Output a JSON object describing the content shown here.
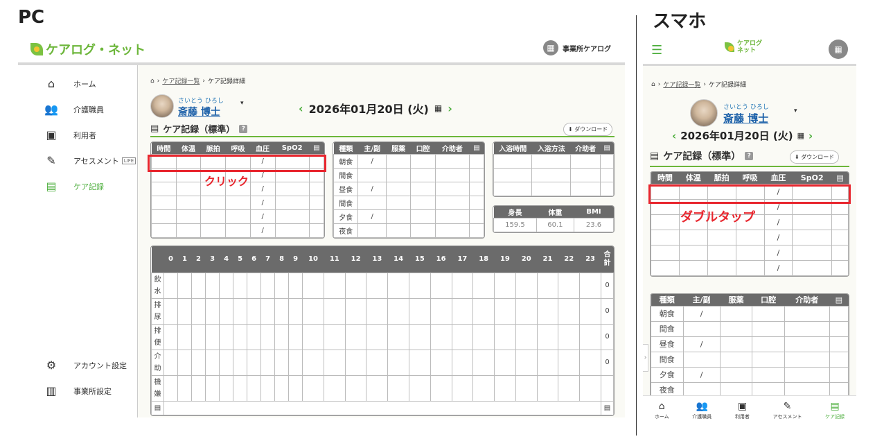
{
  "labels": {
    "pc": "PC",
    "sp": "スマホ"
  },
  "app": {
    "logo_text": "ケアログ・ネット",
    "logo_short_1": "ケアログ",
    "logo_short_2": "ネット",
    "office_name": "事業所ケアログ"
  },
  "sidebar": {
    "items": [
      {
        "label": "ホーム",
        "icon": "⌂"
      },
      {
        "label": "介護職員",
        "icon": "👥"
      },
      {
        "label": "利用者",
        "icon": "▣"
      },
      {
        "label": "アセスメント",
        "icon": "✎",
        "badge": "LIFE"
      },
      {
        "label": "ケア記録",
        "icon": "▤"
      }
    ],
    "bottom_items": [
      {
        "label": "アカウント設定",
        "icon": "⚙"
      },
      {
        "label": "事業所設定",
        "icon": "▥"
      }
    ]
  },
  "breadcrumb": {
    "home_icon": "home-icon",
    "link": "ケア記録一覧",
    "current": "ケア記録詳細"
  },
  "person": {
    "kana": "さいとう ひろし",
    "name": "斎藤 博士"
  },
  "date": {
    "text": "2026年01月20日 (火)"
  },
  "section": {
    "title": "ケア記録（標準）",
    "help": "?",
    "download": "ダウンロード"
  },
  "vitals": {
    "headers": [
      "時間",
      "体温",
      "脈拍",
      "呼吸",
      "血圧",
      "SpO2"
    ],
    "slash": "/"
  },
  "meals": {
    "headers": [
      "種類",
      "主/副",
      "服薬",
      "口腔",
      "介助者"
    ],
    "rows": [
      {
        "type": "朝食",
        "main": "/"
      },
      {
        "type": "間食",
        "main": ""
      },
      {
        "type": "昼食",
        "main": "/"
      },
      {
        "type": "間食",
        "main": ""
      },
      {
        "type": "夕食",
        "main": "/"
      },
      {
        "type": "夜食",
        "main": ""
      }
    ]
  },
  "bath": {
    "headers": [
      "入浴時間",
      "入浴方法",
      "介助者"
    ]
  },
  "body": {
    "headers": [
      "身長",
      "体重",
      "BMI"
    ],
    "values": [
      "159.5",
      "60.1",
      "23.6"
    ]
  },
  "hourly": {
    "hours": [
      "0",
      "1",
      "2",
      "3",
      "4",
      "5",
      "6",
      "7",
      "8",
      "9",
      "10",
      "11",
      "12",
      "13",
      "14",
      "15",
      "16",
      "17",
      "18",
      "19",
      "20",
      "21",
      "22",
      "23"
    ],
    "total_label": "合計",
    "rows": [
      {
        "label": "飲水",
        "total": "0"
      },
      {
        "label": "排尿",
        "total": "0"
      },
      {
        "label": "排便",
        "total": "0"
      },
      {
        "label": "介助",
        "total": "0"
      },
      {
        "label": "機嫌",
        "total": ""
      }
    ]
  },
  "annotations": {
    "pc": "クリック",
    "sp": "ダブルタップ"
  },
  "colors": {
    "accent": "#4cae3c",
    "highlight": "#e8262e",
    "header_bg": "#6b6b6b"
  },
  "bottom_nav": [
    {
      "label": "ホーム",
      "icon": "⌂"
    },
    {
      "label": "介護職員",
      "icon": "👥"
    },
    {
      "label": "利用者",
      "icon": "▣"
    },
    {
      "label": "アセスメント",
      "icon": "✎"
    },
    {
      "label": "ケア記録",
      "icon": "▤"
    }
  ]
}
